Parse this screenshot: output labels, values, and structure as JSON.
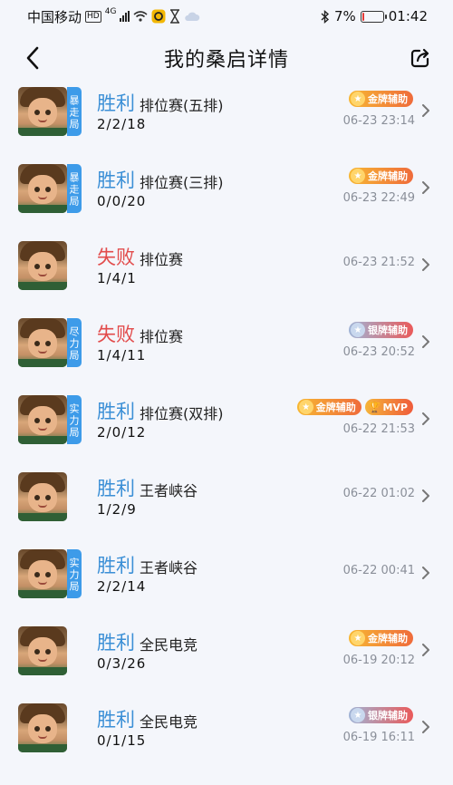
{
  "status_bar": {
    "carrier": "中国移动",
    "network": "4G",
    "hd": "HD",
    "battery": "7%",
    "time": "01:42"
  },
  "header": {
    "title": "我的桑启详情"
  },
  "matches": [
    {
      "result": "胜利",
      "outcome": "win",
      "mode": "排位赛(五排)",
      "kda": "2/2/18",
      "time": "06-23 23:14",
      "tag": "暴走局",
      "badges": [
        {
          "type": "gold",
          "label": "金牌辅助"
        }
      ]
    },
    {
      "result": "胜利",
      "outcome": "win",
      "mode": "排位赛(三排)",
      "kda": "0/0/20",
      "time": "06-23 22:49",
      "tag": "暴走局",
      "badges": [
        {
          "type": "gold",
          "label": "金牌辅助"
        }
      ]
    },
    {
      "result": "失败",
      "outcome": "lose",
      "mode": "排位赛",
      "kda": "1/4/1",
      "time": "06-23 21:52",
      "tag": "",
      "badges": []
    },
    {
      "result": "失败",
      "outcome": "lose",
      "mode": "排位赛",
      "kda": "1/4/11",
      "time": "06-23 20:52",
      "tag": "尽力局",
      "badges": [
        {
          "type": "silver",
          "label": "银牌辅助"
        }
      ]
    },
    {
      "result": "胜利",
      "outcome": "win",
      "mode": "排位赛(双排)",
      "kda": "2/0/12",
      "time": "06-22 21:53",
      "tag": "实力局",
      "badges": [
        {
          "type": "gold",
          "label": "金牌辅助"
        },
        {
          "type": "mvp",
          "label": "MVP"
        }
      ]
    },
    {
      "result": "胜利",
      "outcome": "win",
      "mode": "王者峡谷",
      "kda": "1/2/9",
      "time": "06-22 01:02",
      "tag": "",
      "badges": []
    },
    {
      "result": "胜利",
      "outcome": "win",
      "mode": "王者峡谷",
      "kda": "2/2/14",
      "time": "06-22 00:41",
      "tag": "实力局",
      "badges": []
    },
    {
      "result": "胜利",
      "outcome": "win",
      "mode": "全民电竞",
      "kda": "0/3/26",
      "time": "06-19 20:12",
      "tag": "",
      "badges": [
        {
          "type": "gold",
          "label": "金牌辅助"
        }
      ]
    },
    {
      "result": "胜利",
      "outcome": "win",
      "mode": "全民电竞",
      "kda": "0/1/15",
      "time": "06-19 16:11",
      "tag": "",
      "badges": [
        {
          "type": "silver",
          "label": "银牌辅助"
        }
      ]
    }
  ],
  "colors": {
    "win": "#3b8fd6",
    "lose": "#e24b4b",
    "tag": "#3d9be9"
  }
}
